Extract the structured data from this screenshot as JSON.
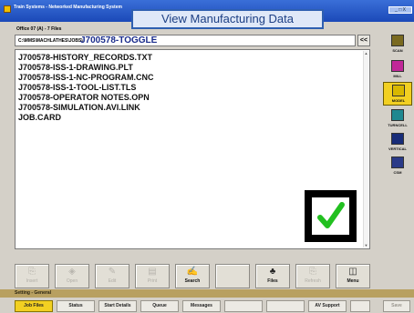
{
  "window": {
    "app_title": "Train Systems - Networked Manufacturing System",
    "controls": "_ □ X"
  },
  "overlay_title": "View Manufacturing Data",
  "office_label": "Office 07 (A) - 7 Files",
  "path": {
    "prefix": "C:\\MMS\\MACHLATHES\\JOBS\\",
    "job": "J700578-TOGGLE"
  },
  "back_button": "<<",
  "files": [
    "J700578-HISTORY_RECORDS.TXT",
    "J700578-ISS-1-DRAWING.PLT",
    "J700578-ISS-1-NC-PROGRAM.CNC",
    "J700578-ISS-1-TOOL-LIST.TLS",
    "J700578-OPERATOR NOTES.OPN",
    "J700578-SIMULATION.AVI.LINK",
    "JOB.CARD"
  ],
  "toolbar": [
    {
      "label": "Insert",
      "icon": "copy-icon",
      "glyph": "⎘",
      "enabled": false
    },
    {
      "label": "Open",
      "icon": "open-icon",
      "glyph": "◈",
      "enabled": false
    },
    {
      "label": "Edit",
      "icon": "edit-icon",
      "glyph": "✎",
      "enabled": false
    },
    {
      "label": "Print",
      "icon": "print-icon",
      "glyph": "▤",
      "enabled": false
    },
    {
      "label": "Search",
      "icon": "search-pen-icon",
      "glyph": "✍",
      "enabled": true
    },
    {
      "label": "",
      "icon": "",
      "glyph": "",
      "enabled": false
    },
    {
      "label": "Files",
      "icon": "files-icon",
      "glyph": "♣",
      "enabled": true
    },
    {
      "label": "Refresh",
      "icon": "copy-icon",
      "glyph": "⎘",
      "enabled": false
    },
    {
      "label": "Menu",
      "icon": "menu-icon",
      "glyph": "◫",
      "enabled": true
    }
  ],
  "section_label": "Setting - General",
  "tabs": [
    {
      "label": "Job Files",
      "active": true
    },
    {
      "label": "Status",
      "active": false
    },
    {
      "label": "Start Details",
      "active": false
    },
    {
      "label": "Queue",
      "active": false
    },
    {
      "label": "Messages",
      "active": false
    },
    {
      "label": "",
      "active": false
    },
    {
      "label": "",
      "active": false
    },
    {
      "label": "AV Support",
      "active": false
    },
    {
      "label": "",
      "active": false
    },
    {
      "label": "Save",
      "active": false,
      "dim": true
    }
  ],
  "sidebar": [
    {
      "label": "SCAN",
      "icon": "scanner-icon",
      "color": "#7a6a20",
      "active": false
    },
    {
      "label": "MILL",
      "icon": "mill-icon",
      "color": "#c02898",
      "active": false
    },
    {
      "label": "MODEL",
      "icon": "model-icon",
      "color": "#d8b800",
      "active": true
    },
    {
      "label": "TURNCELL",
      "icon": "turncell-icon",
      "color": "#208890",
      "active": false
    },
    {
      "label": "VERTICAL",
      "icon": "vertical-icon",
      "color": "#182c78",
      "active": false
    },
    {
      "label": "CSM",
      "icon": "csm-icon",
      "color": "#2a3a88",
      "active": false
    }
  ],
  "status": {
    "complete_check": true
  },
  "colors": {
    "title_bar": "#1b49b8",
    "accent_yellow": "#f2d022",
    "check_green": "#22c020",
    "path_blue": "#1a2c8c"
  }
}
